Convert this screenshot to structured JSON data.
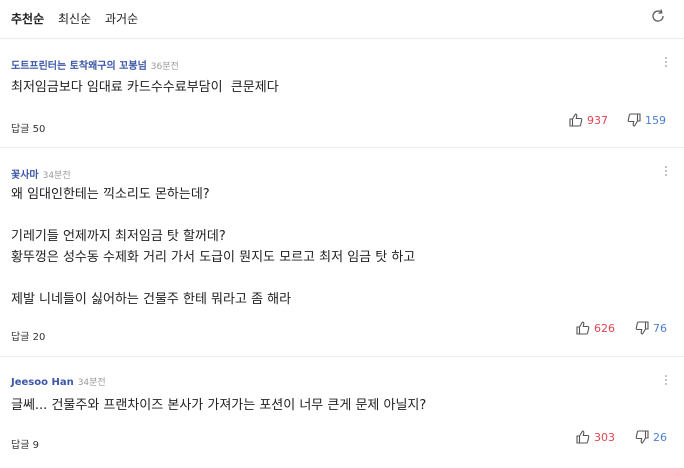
{
  "sort": {
    "tabs": [
      "추천순",
      "최신순",
      "과거순"
    ],
    "active_index": 0,
    "refresh_icon": "refresh-icon"
  },
  "comments": [
    {
      "author": "도트프린터는 토착왜구의 꼬봉넘",
      "time": "36분전",
      "text": "최저임금보다 임대료 카드수수료부담이  큰문제다",
      "reply_label": "답글 50",
      "likes": "937",
      "dislikes": "159"
    },
    {
      "author": "꽃사마",
      "time": "34분전",
      "text": "왜 임대인한테는 끽소리도 몬하는데?\n\n기레기들 언제까지 최저임금 탓 할꺼데?\n황뚜껑은 성수동 수제화 거리 가서 도급이 뭔지도 모르고 최저 임금 탓 하고\n\n제발 니네들이 싫어하는 건물주 한테 뭐라고 좀 해라",
      "reply_label": "답글 20",
      "likes": "626",
      "dislikes": "76"
    },
    {
      "author": "Jeesoo Han",
      "time": "34분전",
      "text": "글쎄... 건물주와 프랜차이즈 본사가 가져가는 포션이 너무 큰게 문제 아닐지?",
      "reply_label": "답글 9",
      "likes": "303",
      "dislikes": "26"
    }
  ],
  "colors": {
    "author": "#3b57a8",
    "like": "#e0454f",
    "dislike": "#4c7fd1"
  }
}
